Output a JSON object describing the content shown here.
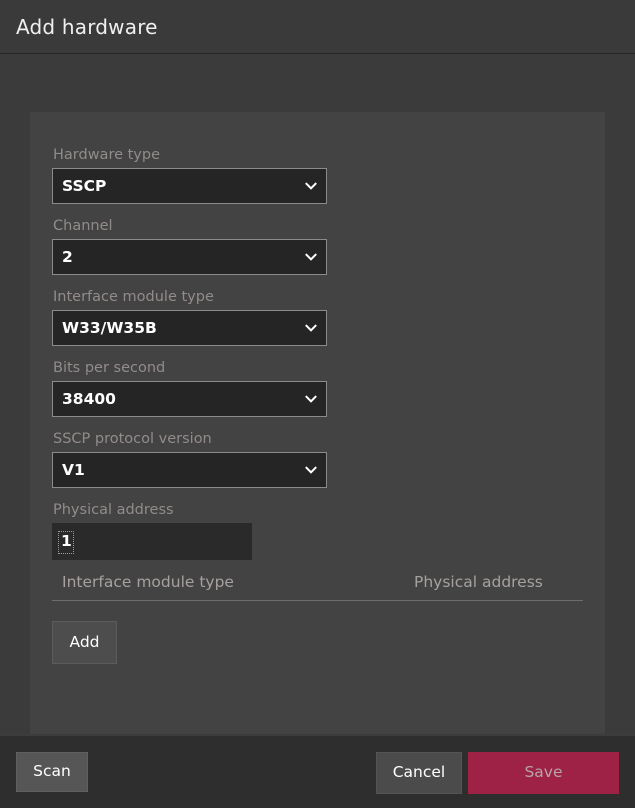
{
  "window": {
    "title": "Add hardware"
  },
  "form": {
    "fields": [
      {
        "label": "Hardware type",
        "value": "SSCP",
        "control": "select",
        "icon": "chevron-down-icon",
        "name": "hardware-type"
      },
      {
        "label": "Channel",
        "value": "2",
        "control": "select",
        "icon": "chevron-down-icon",
        "name": "channel"
      },
      {
        "label": "Interface module type",
        "value": "W33/W35B",
        "control": "select",
        "icon": "chevron-down-icon",
        "name": "interface-module-type"
      },
      {
        "label": "Bits per second",
        "value": "38400",
        "control": "select",
        "icon": "chevron-down-icon",
        "name": "bits-per-second"
      },
      {
        "label": "SSCP protocol version",
        "value": "V1",
        "control": "select",
        "icon": "chevron-down-icon",
        "name": "sscp-protocol-version"
      },
      {
        "label": "Physical address",
        "value": "1",
        "control": "text",
        "placeholder": "",
        "name": "physical-address"
      }
    ]
  },
  "table": {
    "columns": [
      "Interface module type",
      "Physical address"
    ],
    "rows": []
  },
  "buttons": {
    "add": "Add",
    "scan": "Scan",
    "cancel": "Cancel",
    "save": "Save"
  },
  "colors": {
    "window_background": "#2e2e2e",
    "titlebar": "#3a3a3a",
    "content": "#3b3b3b",
    "card": "#434343",
    "input_background": "#252525",
    "input_border": "#8b8b8b",
    "label_text": "#918c8a",
    "save_accent": "#9e2246",
    "button_gray": "#4d4d4d"
  }
}
